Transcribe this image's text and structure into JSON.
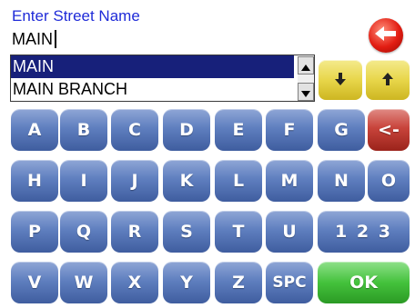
{
  "header": {
    "prompt": "Enter Street Name",
    "input_value": "MAIN"
  },
  "icons": {
    "back": "back-arrow-icon",
    "scroll_up": "triangle-up-icon",
    "scroll_down": "triangle-down-icon",
    "nav_down": "arrow-down-icon",
    "nav_up": "arrow-up-icon"
  },
  "results": {
    "items": [
      {
        "label": "MAIN",
        "selected": true
      },
      {
        "label": "MAIN BRANCH",
        "selected": false
      }
    ]
  },
  "keyboard": {
    "row1": [
      "A",
      "B",
      "C",
      "D",
      "E",
      "F",
      "G",
      "<-"
    ],
    "row2": [
      "H",
      "I",
      "J",
      "K",
      "L",
      "M",
      "N",
      "O"
    ],
    "row3": [
      "P",
      "Q",
      "R",
      "S",
      "T",
      "U"
    ],
    "numbers_label": "1 2 3",
    "row4": [
      "V",
      "W",
      "X",
      "Y",
      "Z",
      "SPC"
    ],
    "ok_label": "OK"
  },
  "colors": {
    "prompt_text": "#1f2bd8",
    "selection": "#17207a",
    "key_blue": "#5f7fbf",
    "key_red": "#c8443b",
    "key_green": "#44c23c",
    "nav_yellow": "#e8d64a",
    "back_button": "#e21d12"
  }
}
